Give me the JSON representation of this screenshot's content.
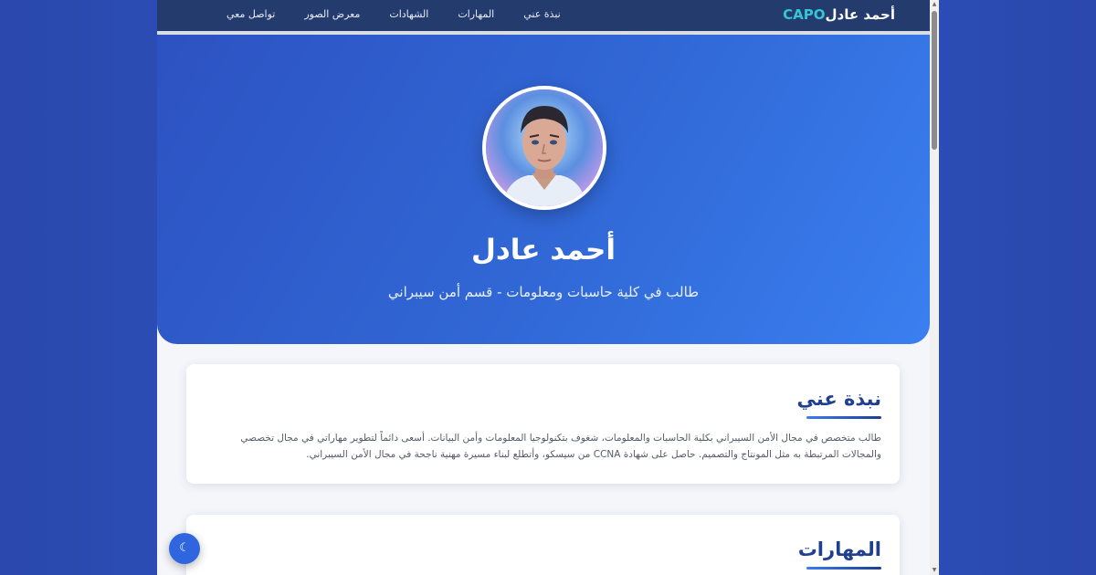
{
  "nav": {
    "brand_prefix": "CAPO",
    "brand_name": "أحمد عادل",
    "items": [
      {
        "label": "نبذة عني"
      },
      {
        "label": "المهارات"
      },
      {
        "label": "الشهادات"
      },
      {
        "label": "معرض الصور"
      },
      {
        "label": "تواصل معي"
      }
    ]
  },
  "hero": {
    "name": "أحمد عادل",
    "subtitle": "طالب في كلية حاسبات ومعلومات - قسم أمن سيبراني"
  },
  "about": {
    "title": "نبذة عني",
    "text": "طالب متخصص في مجال الأمن السيبراني بكلية الحاسبات والمعلومات، شغوف بتكنولوجيا المعلومات وأمن البيانات. أسعى دائماً لتطوير مهاراتي في مجال تخصصي والمجالات المرتبطة به مثل المونتاج والتصميم. حاصل على شهادة CCNA من سيسكو، وأتطلع لبناء مسيرة مهنية ناجحة في مجال الأمن السيبراني."
  },
  "skills": {
    "title": "المهارات"
  },
  "theme_toggle": {
    "glyph": "☾"
  },
  "colors": {
    "nav_bg": "#243b6e",
    "accent": "#3168d6",
    "heading": "#1f3f8f",
    "brand_accent": "#35c6d4"
  }
}
